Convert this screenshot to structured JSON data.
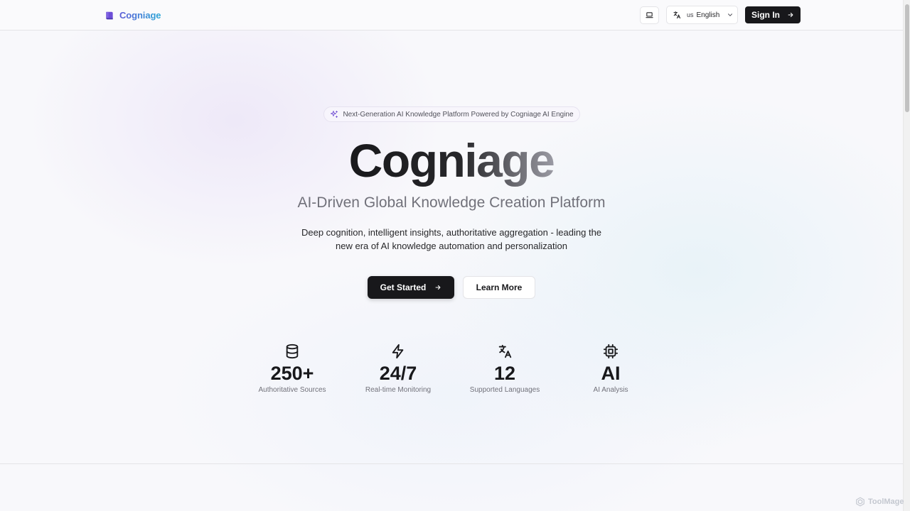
{
  "header": {
    "brand": "Cogniage",
    "language_code": "us",
    "language_name": "English",
    "signin_label": "Sign In"
  },
  "hero": {
    "badge_text": "Next-Generation AI Knowledge Platform Powered by Cogniage AI Engine",
    "title": "Cogniage",
    "subtitle": "AI-Driven Global Knowledge Creation Platform",
    "description": "Deep cognition, intelligent insights, authoritative aggregation - leading the new era of AI knowledge automation and personalization",
    "primary_cta": "Get Started",
    "secondary_cta": "Learn More"
  },
  "stats": [
    {
      "icon": "database-icon",
      "value": "250+",
      "label": "Authoritative Sources"
    },
    {
      "icon": "lightning-icon",
      "value": "24/7",
      "label": "Real-time Monitoring"
    },
    {
      "icon": "translate-icon",
      "value": "12",
      "label": "Supported Languages"
    },
    {
      "icon": "cpu-chip-icon",
      "value": "AI",
      "label": "AI Analysis"
    }
  ],
  "watermark": "ToolMage",
  "colors": {
    "brand_gradient_start": "#5b5bd6",
    "brand_gradient_end": "#2aa7d8",
    "primary_button": "#18181b",
    "muted_text": "#71717a"
  }
}
